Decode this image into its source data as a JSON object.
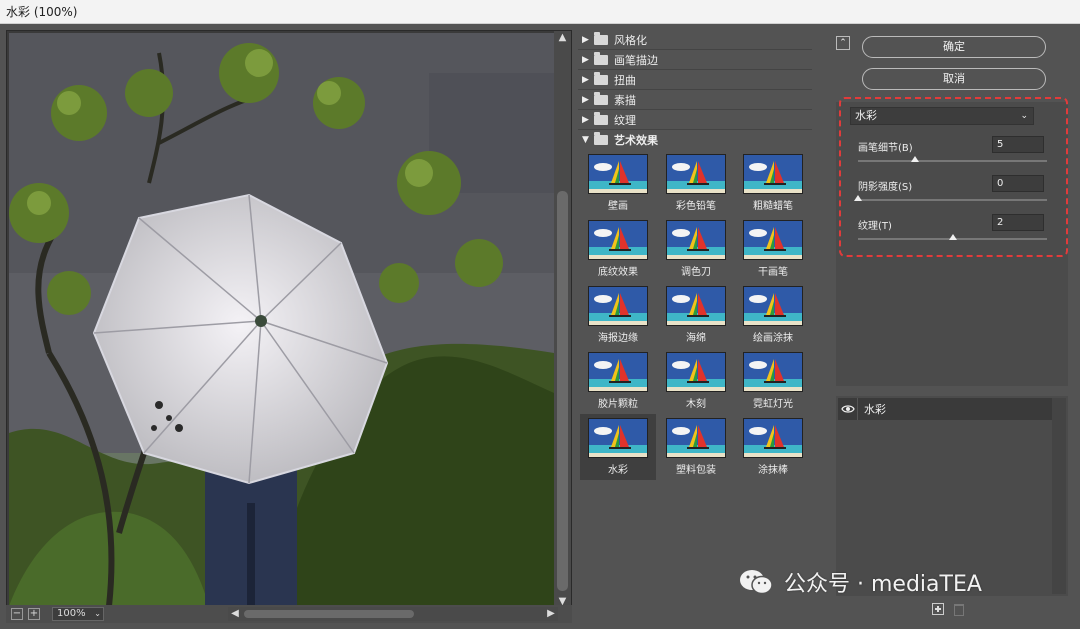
{
  "window": {
    "title": "水彩 (100%)"
  },
  "preview": {
    "zoom": "100%"
  },
  "categories": [
    {
      "label": "风格化",
      "expanded": false
    },
    {
      "label": "画笔描边",
      "expanded": false
    },
    {
      "label": "扭曲",
      "expanded": false
    },
    {
      "label": "素描",
      "expanded": false
    },
    {
      "label": "纹理",
      "expanded": false
    },
    {
      "label": "艺术效果",
      "expanded": true
    }
  ],
  "filters": [
    {
      "label": "壁画"
    },
    {
      "label": "彩色铅笔"
    },
    {
      "label": "粗糙蜡笔"
    },
    {
      "label": "底纹效果"
    },
    {
      "label": "调色刀"
    },
    {
      "label": "干画笔"
    },
    {
      "label": "海报边缘"
    },
    {
      "label": "海绵"
    },
    {
      "label": "绘画涂抹"
    },
    {
      "label": "胶片颗粒"
    },
    {
      "label": "木刻"
    },
    {
      "label": "霓虹灯光"
    },
    {
      "label": "水彩",
      "selected": true
    },
    {
      "label": "塑料包装"
    },
    {
      "label": "涂抹棒"
    }
  ],
  "buttons": {
    "ok": "确定",
    "cancel": "取消"
  },
  "settings": {
    "filter": "水彩",
    "params": [
      {
        "label": "画笔细节(B)",
        "value": "5",
        "fraction": 0.3
      },
      {
        "label": "阴影强度(S)",
        "value": "0",
        "fraction": 0.0
      },
      {
        "label": "纹理(T)",
        "value": "2",
        "fraction": 0.5
      }
    ]
  },
  "layers": [
    {
      "name": "水彩"
    }
  ],
  "watermark": {
    "text": "公众号 · mediaTEA"
  },
  "colors": {
    "highlight": "#e23b3b",
    "panel": "#535353"
  }
}
